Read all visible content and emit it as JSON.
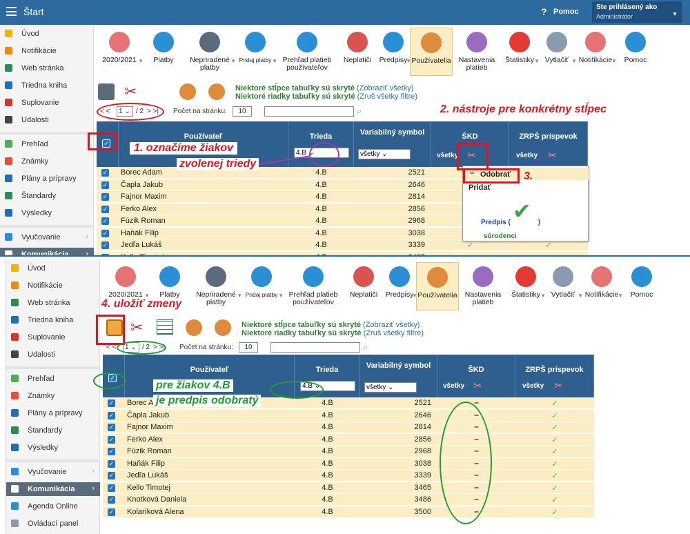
{
  "topbar": {
    "title": "Štart",
    "help_label": "Pomoc",
    "user_label": "Ste prihlásený ako",
    "user_role": "Administrátor"
  },
  "sidebar": {
    "items_top": [
      {
        "label": "Úvod",
        "icon": "star-icon",
        "color": "#f1b400"
      },
      {
        "label": "Notifikácie",
        "icon": "mail-icon",
        "color": "#f08a00"
      },
      {
        "label": "Web stránka",
        "icon": "home-icon",
        "color": "#2e8b57"
      },
      {
        "label": "Triedna kniha",
        "icon": "book-icon",
        "color": "#1e6fb8"
      },
      {
        "label": "Suplovanie",
        "icon": "person-icon",
        "color": "#d9342b"
      },
      {
        "label": "Udalosti",
        "icon": "calendar-icon",
        "color": "#444444"
      }
    ],
    "items_mid": [
      {
        "label": "Prehľad",
        "icon": "check-circle-icon",
        "color": "#4caf50"
      },
      {
        "label": "Známky",
        "icon": "palette-icon",
        "color": "#e74c3c"
      },
      {
        "label": "Plány a prípravy",
        "icon": "plan-icon",
        "color": "#1e6fb8"
      },
      {
        "label": "Štandardy",
        "icon": "shield-icon",
        "color": "#2e8b57"
      },
      {
        "label": "Výsledky",
        "icon": "bar-chart-icon",
        "color": "#1e6fb8"
      }
    ],
    "vyucovanie": "Vyučovanie",
    "komunikacia": "Komunikácia",
    "agenda": "Agenda Online",
    "ovladaci": "Ovládací panel"
  },
  "toolbar": [
    {
      "label": "2020/2021",
      "icon": "calendar-icon",
      "color": "#e57373"
    },
    {
      "label": "Platby",
      "icon": "money-bag-icon",
      "color": "#2b8fd6"
    },
    {
      "label": "Nepriradené platby",
      "icon": "money-bag-icon",
      "color": "#5b6b7b"
    },
    {
      "label": "Pridaj platby",
      "icon": "add-money-icon",
      "color": "#2b8fd6"
    },
    {
      "label": "Prehľad platieb používateľov",
      "icon": "euro-book-icon",
      "color": "#2b8fd6"
    },
    {
      "label": "Neplatiči",
      "icon": "money-bag-warning-icon",
      "color": "#d9534f"
    },
    {
      "label": "Predpisy",
      "icon": "document-icon",
      "color": "#2b8fd6"
    },
    {
      "label": "Používatelia",
      "icon": "user-icon",
      "color": "#e08a3c"
    },
    {
      "label": "Nastavenia platieb",
      "icon": "gear-icon",
      "color": "#9b6bbf"
    },
    {
      "label": "Štatistiky",
      "icon": "pie-chart-icon",
      "color": "#e53935"
    },
    {
      "label": "Vytlačiť",
      "icon": "printer-icon",
      "color": "#8a9bb0"
    },
    {
      "label": "Notifikácie",
      "icon": "phone-icon",
      "color": "#e57373"
    },
    {
      "label": "Pomoc",
      "icon": "help-icon",
      "color": "#2b8fd6"
    }
  ],
  "notes": {
    "cols_hidden": "Niektoré stĺpce tabuľky sú skryté",
    "cols_link": "(Zobraziť všetky)",
    "rows_hidden": "Niektoré riadky tabuľky sú skryté",
    "rows_link": "(Zruš všetky filtre)"
  },
  "pager": {
    "prev": "< <",
    "page": "1",
    "total": "/ 2",
    "next": "> >|",
    "per_page_label": "Počet na stránku:",
    "per_page": "10"
  },
  "table": {
    "headers": {
      "user": "Používateľ",
      "class": "Trieda",
      "vs": "Variabilný symbol",
      "skd": "ŠKD",
      "zrps": "ZRPŠ príspevok"
    },
    "class_filter": "4.B",
    "vs_filter": "všetky",
    "all_label": "všetky",
    "rows": [
      {
        "name": "Borec Adam",
        "class": "4.B",
        "vs": "2521",
        "skd": "tick"
      },
      {
        "name": "Čapla Jakub",
        "class": "4.B",
        "vs": "2646",
        "skd": "tick"
      },
      {
        "name": "Fajnor Maxim",
        "class": "4.B",
        "vs": "2814",
        "skd": "dash"
      },
      {
        "name": "Ferko Alex",
        "class": "4.B",
        "vs": "2856",
        "skd": "dash"
      },
      {
        "name": "Fúzik Roman",
        "class": "4.B",
        "vs": "2968",
        "skd": "tick"
      },
      {
        "name": "Haňák Filip",
        "class": "4.B",
        "vs": "3038",
        "skd": "tick"
      },
      {
        "name": "Jedľa Lukáš",
        "class": "4.B",
        "vs": "3339",
        "skd": "tick"
      },
      {
        "name": "Kello Timotej",
        "class": "4.B",
        "vs": "3465",
        "skd": "tick"
      },
      {
        "name": "Knotková Daniela",
        "class": "4.B",
        "vs": "3486",
        "skd": "dash"
      },
      {
        "name": "Kolaríková Alena",
        "class": "4.B",
        "vs": "3500",
        "skd": "dash"
      }
    ]
  },
  "popup": {
    "remove": "Odobrať",
    "add": "Pridať",
    "predpis": "Predpis (",
    "predpis_end": ")",
    "surodenci": "súrodenci"
  },
  "annotations": {
    "a1": "1.   označíme žiakov",
    "a1b": "zvolenej triedy",
    "a2": "2. nástroje pre konkrétny stĺpec",
    "a3": "3.",
    "a4": "4.  uložiť zmeny",
    "a5": "pre žiakov 4.B",
    "a5b": "je predpis odobratý"
  }
}
